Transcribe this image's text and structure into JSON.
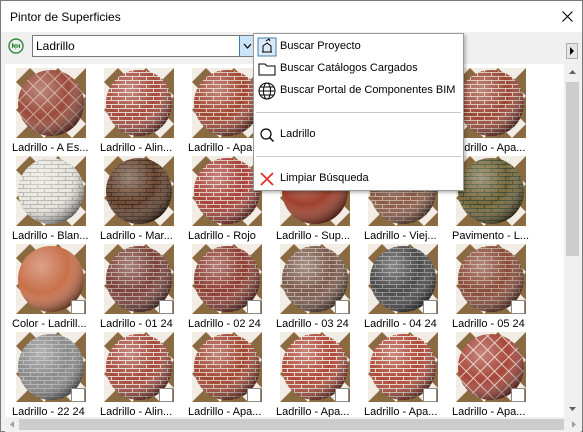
{
  "window": {
    "title": "Pintor de Superficies"
  },
  "toolbar": {
    "search_value": "Ladrillo"
  },
  "dropdown": {
    "items": [
      {
        "label": "Buscar Proyecto",
        "icon": "project-icon"
      },
      {
        "label": "Buscar Catálogos Cargados",
        "icon": "folder-icon"
      },
      {
        "label": "Buscar Portal de Componentes BIM",
        "icon": "globe-icon"
      },
      {
        "label": "Ladrillo",
        "icon": "search-icon"
      },
      {
        "label": "Limpiar Búsqueda",
        "icon": "clear-icon"
      }
    ]
  },
  "materials": [
    {
      "label": "Ladrillo - A Es...",
      "base": "#9a4a3c",
      "mortar": "#c9a48e",
      "pattern": "herringbone",
      "badge": false
    },
    {
      "label": "Ladrillo - Alin...",
      "base": "#a64a3e",
      "mortar": "#e2d3c8",
      "pattern": "brick",
      "badge": false
    },
    {
      "label": "Ladrillo - Apa...",
      "base": "#a34634",
      "mortar": "#d8c2b2",
      "pattern": "brick",
      "badge": false
    },
    {
      "label": "Ladrillo - Apa...",
      "base": "#b04a3a",
      "mortar": "#e6d8cc",
      "pattern": "brick",
      "badge": false
    },
    {
      "label": "Ladrillo - Apa...",
      "base": "#b04a3a",
      "mortar": "#e6d8cc",
      "pattern": "brick",
      "badge": false
    },
    {
      "label": "Ladrillo - Apa...",
      "base": "#9c4636",
      "mortar": "#d6c0b0",
      "pattern": "brick",
      "badge": false
    },
    {
      "label": "Ladrillo - Blan...",
      "base": "#e8e6e0",
      "mortar": "#b8b5ae",
      "pattern": "brick",
      "badge": false
    },
    {
      "label": "Ladrillo - Mar...",
      "base": "#6e4a34",
      "mortar": "#3e2a1e",
      "pattern": "brick",
      "badge": false
    },
    {
      "label": "Ladrillo - Rojo",
      "base": "#a8423a",
      "mortar": "#dcc6b8",
      "pattern": "brick",
      "badge": false
    },
    {
      "label": "Ladrillo - Sup...",
      "base": "#a0402c",
      "mortar": "#a0402c",
      "pattern": "plain",
      "badge": false
    },
    {
      "label": "Ladrillo - Viej...",
      "base": "#8a5a46",
      "mortar": "#c0a898",
      "pattern": "brick",
      "badge": false
    },
    {
      "label": "Pavimento - L...",
      "base": "#7a6a3e",
      "mortar": "#3e4a2e",
      "pattern": "brick",
      "badge": false
    },
    {
      "label": "Color - Ladrill...",
      "base": "#c8704a",
      "mortar": "#c8704a",
      "pattern": "plain",
      "badge": true
    },
    {
      "label": "Ladrillo - 01 24",
      "base": "#7a4038",
      "mortar": "#b49a90",
      "pattern": "brick",
      "badge": true
    },
    {
      "label": "Ladrillo - 02 24",
      "base": "#8e3c34",
      "mortar": "#c0a090",
      "pattern": "brick",
      "badge": true
    },
    {
      "label": "Ladrillo - 03 24",
      "base": "#7a5a4a",
      "mortar": "#b8a49a",
      "pattern": "brick",
      "badge": true
    },
    {
      "label": "Ladrillo - 04 24",
      "base": "#4a4a4a",
      "mortar": "#8e8e8e",
      "pattern": "brick",
      "badge": true
    },
    {
      "label": "Ladrillo - 05 24",
      "base": "#8a4a3a",
      "mortar": "#b89a88",
      "pattern": "brick",
      "badge": true
    },
    {
      "label": "Ladrillo - 22 24",
      "base": "#8a8a8a",
      "mortar": "#b4b4b4",
      "pattern": "brick",
      "badge": true
    },
    {
      "label": "Ladrillo - Alin...",
      "base": "#a64a3e",
      "mortar": "#e2d3c8",
      "pattern": "brick",
      "badge": true
    },
    {
      "label": "Ladrillo - Apa...",
      "base": "#a34634",
      "mortar": "#d8c2b2",
      "pattern": "brick",
      "badge": true
    },
    {
      "label": "Ladrillo - Apa...",
      "base": "#b04a3a",
      "mortar": "#e6d8cc",
      "pattern": "brick",
      "badge": true
    },
    {
      "label": "Ladrillo - Apa...",
      "base": "#b04a3a",
      "mortar": "#e6d8cc",
      "pattern": "brick",
      "badge": true
    },
    {
      "label": "Ladrillo - Apa...",
      "base": "#a8463a",
      "mortar": "#e0cec2",
      "pattern": "herringbone",
      "badge": true
    }
  ]
}
